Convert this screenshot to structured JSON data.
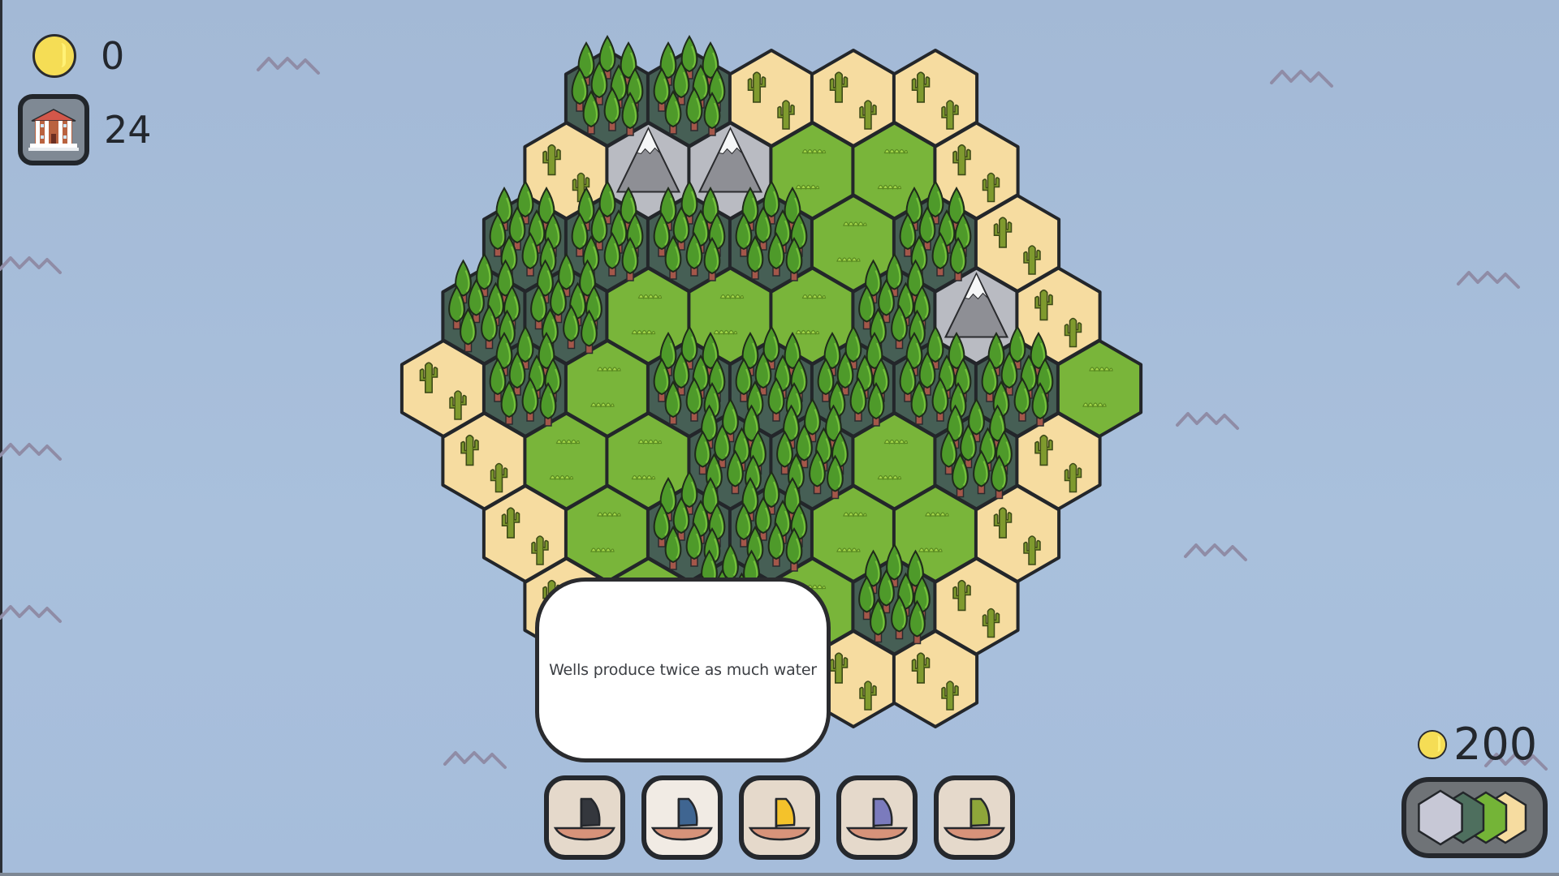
{
  "hud": {
    "coins": {
      "icon": "coin-icon",
      "value": "0"
    },
    "buildings": {
      "icon": "museum-building-icon",
      "value": "24"
    }
  },
  "tooltip": {
    "text": "Wells produce twice as much water"
  },
  "boats": [
    {
      "label": "dark boat",
      "sail_color": "#34373d",
      "selected": false
    },
    {
      "label": "blue boat",
      "sail_color": "#3f6591",
      "selected": true
    },
    {
      "label": "yellow boat",
      "sail_color": "#f4c22b",
      "selected": false
    },
    {
      "label": "purple boat",
      "sail_color": "#7b7bbd",
      "selected": false
    },
    {
      "label": "olive boat",
      "sail_color": "#8ea63a",
      "selected": false
    }
  ],
  "tile_pack": {
    "price": "200",
    "tiles": [
      "mountain",
      "forest",
      "grass",
      "desert"
    ]
  },
  "terrain_colors": {
    "desert": "#f6dca0",
    "grass": "#79b53a",
    "forest": "#465f55",
    "mountain": "#b9bbc2",
    "water": "#a6bddb"
  },
  "map": {
    "rows": [
      [
        "forest",
        "forest",
        "desert",
        "desert",
        "desert"
      ],
      [
        "desert",
        "mountain",
        "mountain",
        "grass",
        "grass",
        "desert"
      ],
      [
        "forest",
        "forest",
        "forest",
        "forest",
        "grass",
        "forest",
        "desert"
      ],
      [
        "forest",
        "forest",
        "grass",
        "grass",
        "grass",
        "forest",
        "mountain",
        "desert"
      ],
      [
        "desert",
        "forest",
        "grass",
        "forest",
        "forest",
        "forest",
        "forest",
        "forest",
        "grass"
      ],
      [
        "desert",
        "grass",
        "grass",
        "forest",
        "forest",
        "grass",
        "forest",
        "desert"
      ],
      [
        "desert",
        "grass",
        "forest",
        "forest",
        "grass",
        "grass",
        "desert"
      ],
      [
        "desert",
        "grass",
        "forest",
        "grass",
        "forest",
        "desert"
      ],
      [
        "desert",
        "grass",
        "forest",
        "desert",
        "desert"
      ]
    ]
  }
}
